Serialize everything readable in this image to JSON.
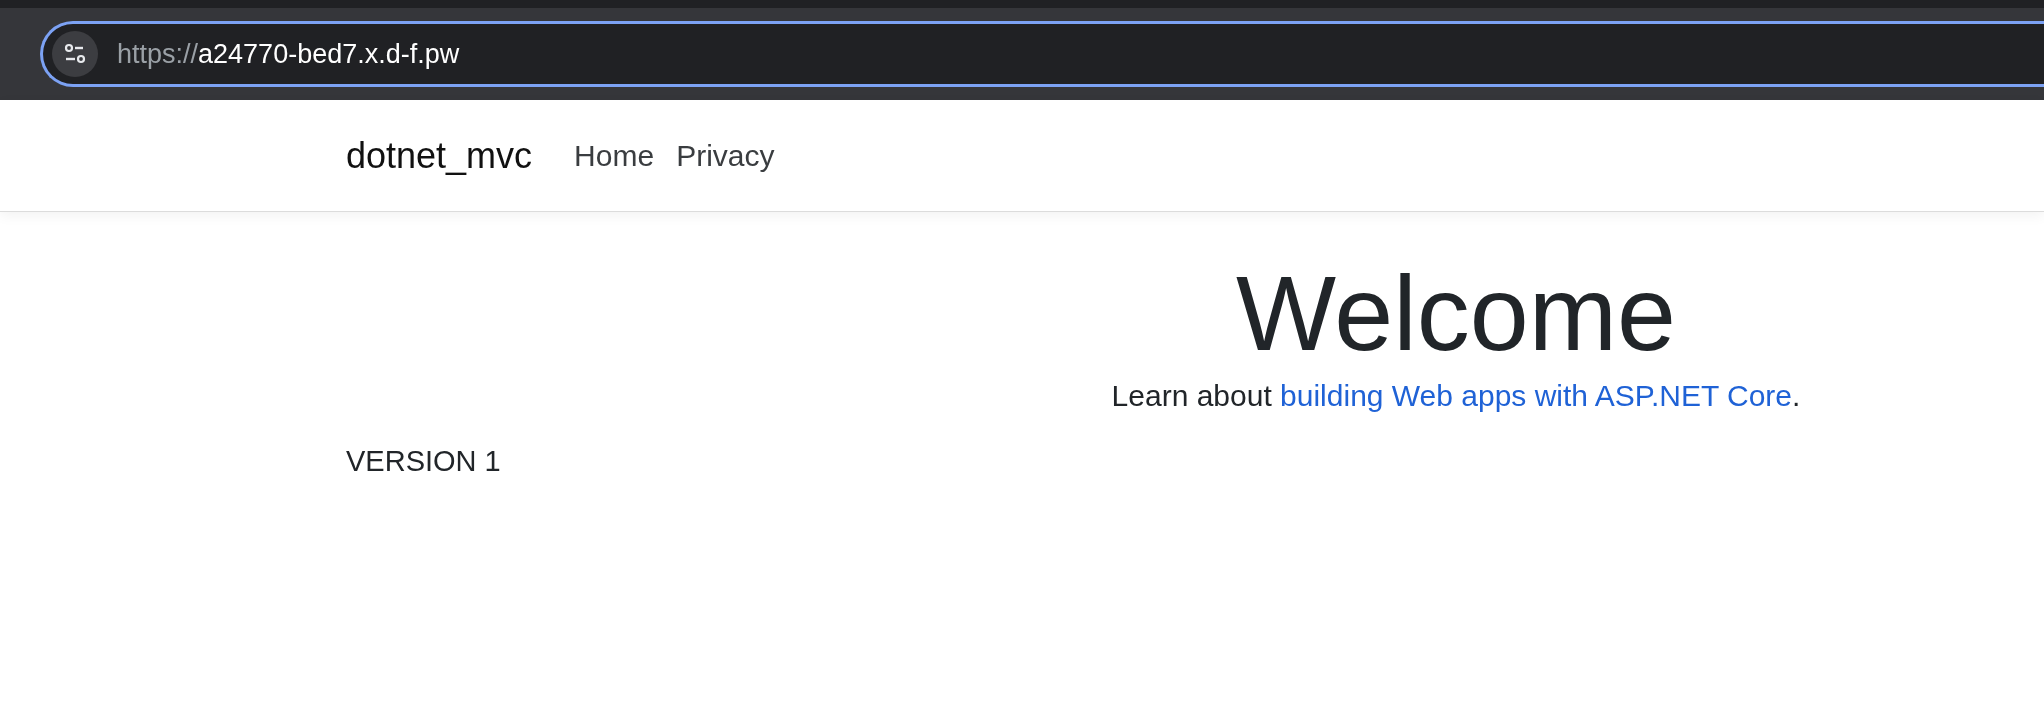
{
  "browser": {
    "url_scheme": "https://",
    "url_host": "a24770-bed7.x.d-f.pw"
  },
  "navbar": {
    "brand": "dotnet_mvc",
    "links": [
      {
        "label": "Home"
      },
      {
        "label": "Privacy"
      }
    ]
  },
  "hero": {
    "heading": "Welcome",
    "lead_before": "Learn about ",
    "link": "building Web apps with ASP.NET Core",
    "lead_after": "."
  },
  "footer_text": "VERSION 1"
}
